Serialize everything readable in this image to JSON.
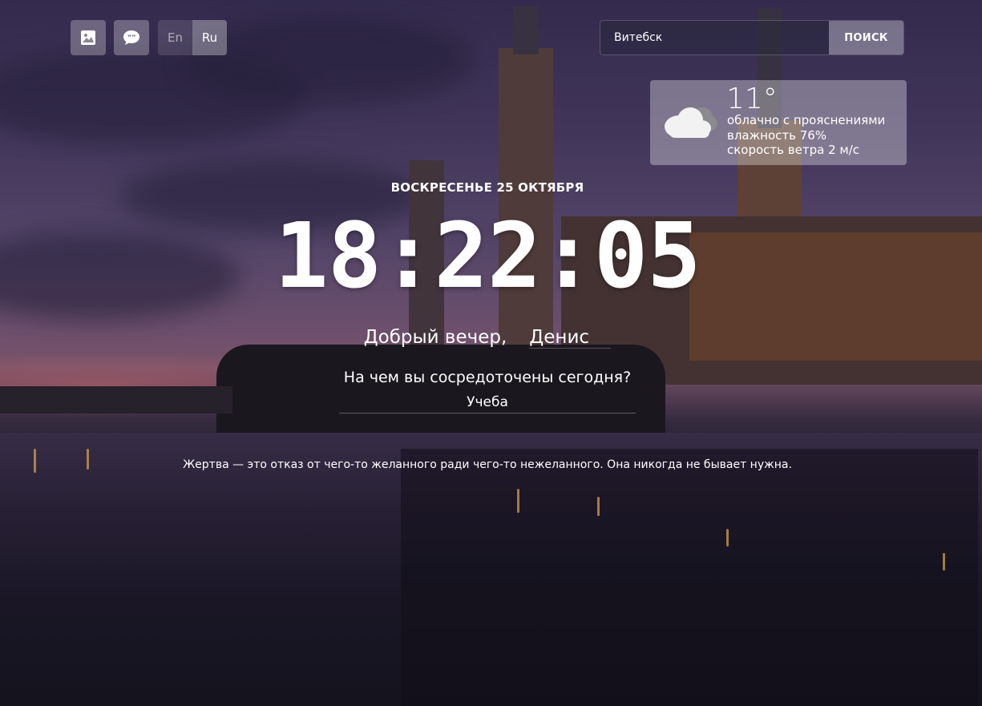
{
  "toolbar": {
    "background_icon": "image-icon",
    "quote_icon": "quote-bubble-icon",
    "lang_en": "En",
    "lang_ru": "Ru",
    "active_lang": "Ru"
  },
  "search": {
    "value": "Витебск",
    "button_label": "поиск"
  },
  "weather": {
    "icon": "cloud-icon",
    "temperature": "11°",
    "description": "облачно с прояснениями",
    "humidity": "влажность 76%",
    "wind": "скорость ветра 2 м/с"
  },
  "main": {
    "date": "воскресенье 25 октября",
    "time": "18:22:05",
    "greeting": "Добрый вечер,",
    "name": "Денис",
    "focus_question": "На чем вы сосредоточены сегодня?",
    "focus_answer": "Учеба",
    "quote": "Жертва — это отказ от чего-то желанного ради чего-то нежеланного. Она никогда не бывает нужна."
  }
}
